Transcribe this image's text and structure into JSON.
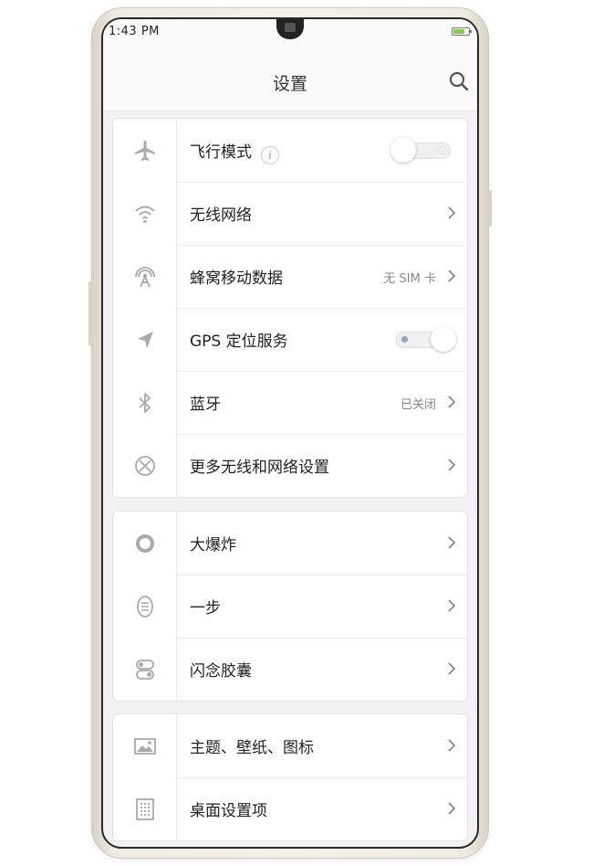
{
  "status_bar": {
    "time": "1:43 PM"
  },
  "header": {
    "title": "设置"
  },
  "group1": [
    {
      "label": "飞行模式",
      "icon": "airplane-icon",
      "control": "toggle",
      "state": "off",
      "info": "i"
    },
    {
      "label": "无线网络",
      "icon": "wifi-icon",
      "control": "chevron"
    },
    {
      "label": "蜂窝移动数据",
      "icon": "cellular-icon",
      "control": "chevron",
      "value": "无 SIM 卡"
    },
    {
      "label": "GPS 定位服务",
      "icon": "location-icon",
      "control": "toggle",
      "state": "on"
    },
    {
      "label": "蓝牙",
      "icon": "bluetooth-icon",
      "control": "chevron",
      "value": "已关闭"
    },
    {
      "label": "更多无线和网络设置",
      "icon": "network-more-icon",
      "control": "chevron"
    }
  ],
  "group2": [
    {
      "label": "大爆炸",
      "icon": "big-bang-icon",
      "control": "chevron"
    },
    {
      "label": "一步",
      "icon": "one-step-icon",
      "control": "chevron"
    },
    {
      "label": "闪念胶囊",
      "icon": "capsule-icon",
      "control": "chevron"
    }
  ],
  "group3": [
    {
      "label": "主题、壁纸、图标",
      "icon": "wallpaper-icon",
      "control": "chevron"
    },
    {
      "label": "桌面设置项",
      "icon": "desktop-grid-icon",
      "control": "chevron"
    }
  ],
  "colors": {
    "background": "#f2f2f2",
    "card": "#ffffff",
    "text": "#222222",
    "secondary": "#888888"
  }
}
